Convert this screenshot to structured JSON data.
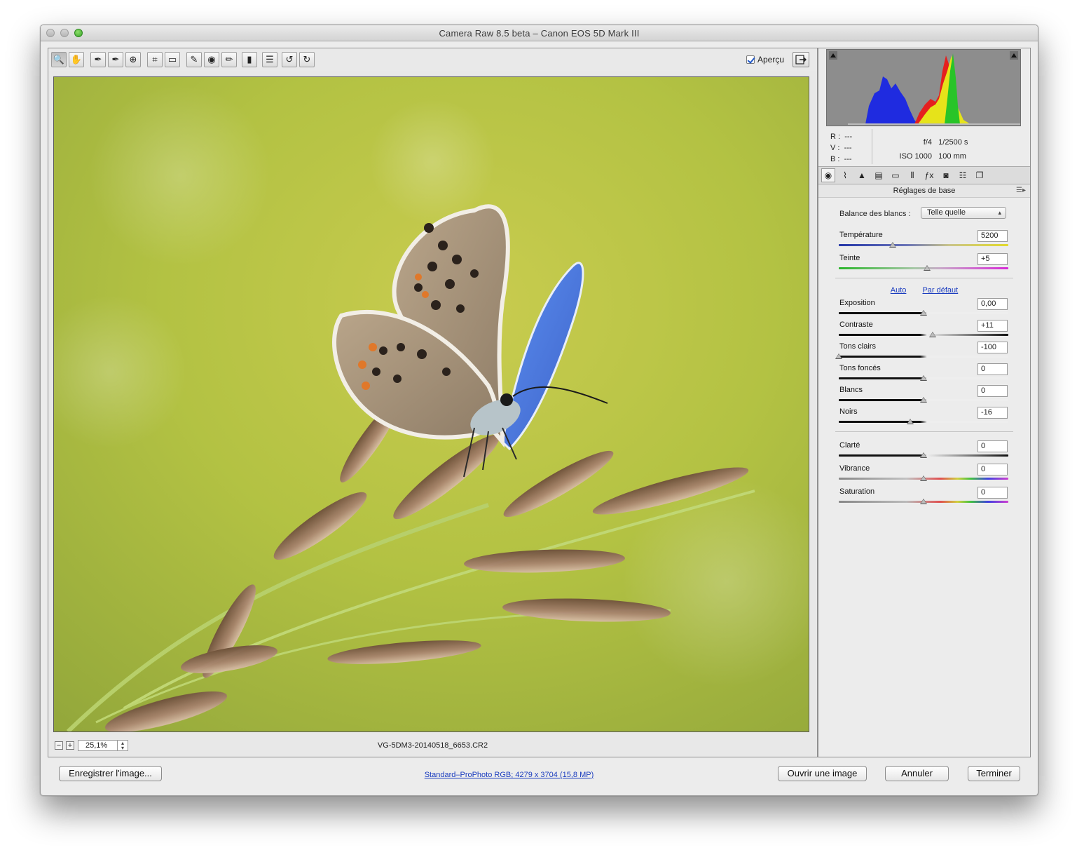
{
  "window": {
    "title": "Camera Raw 8.5 beta  –  Canon EOS 5D Mark III"
  },
  "toolbar": {
    "tools": [
      {
        "name": "zoom-tool",
        "icon": "magnifier-icon",
        "glyph": "🔍"
      },
      {
        "name": "hand-tool",
        "icon": "hand-icon",
        "glyph": "✋"
      },
      {
        "name": "white-balance-tool",
        "icon": "eyedropper-icon",
        "glyph": "✒"
      },
      {
        "name": "color-sampler-tool",
        "icon": "color-sampler-icon",
        "glyph": "✒"
      },
      {
        "name": "targeted-adjustment-tool",
        "icon": "target-icon",
        "glyph": "⊕"
      },
      {
        "name": "crop-tool",
        "icon": "crop-icon",
        "glyph": "⌗"
      },
      {
        "name": "straighten-tool",
        "icon": "level-icon",
        "glyph": "▭"
      },
      {
        "name": "spot-removal-tool",
        "icon": "brush-spot-icon",
        "glyph": "✎"
      },
      {
        "name": "red-eye-tool",
        "icon": "eye-icon",
        "glyph": "◉"
      },
      {
        "name": "adjustment-brush-tool",
        "icon": "brush-icon",
        "glyph": "✏"
      },
      {
        "name": "graduated-filter-tool",
        "icon": "gradient-icon",
        "glyph": "▮"
      },
      {
        "name": "preferences-tool",
        "icon": "list-icon",
        "glyph": "☰"
      },
      {
        "name": "rotate-left-tool",
        "icon": "rotate-left-icon",
        "glyph": "↺"
      },
      {
        "name": "rotate-right-tool",
        "icon": "rotate-right-icon",
        "glyph": "↻"
      }
    ],
    "preview_label": "Aperçu",
    "preview_checked": true
  },
  "status": {
    "zoom": "25,1%",
    "filename": "VG-5DM3-20140518_6653.CR2"
  },
  "readout": {
    "r_label": "R :",
    "r_value": "---",
    "v_label": "V :",
    "v_value": "---",
    "b_label": "B :",
    "b_value": "---",
    "aperture": "f/4",
    "shutter": "1/2500 s",
    "iso": "ISO 1000",
    "focal": "100 mm"
  },
  "panel": {
    "tabs": [
      "aperture-icon",
      "curve-icon",
      "triangle-icon",
      "split-icon",
      "bar-icon",
      "lens-icon",
      "fx-icon",
      "camera-icon",
      "sliders-icon",
      "presets-icon"
    ],
    "title": "Réglages de base",
    "white_balance_label": "Balance des blancs :",
    "white_balance_value": "Telle quelle",
    "auto_label": "Auto",
    "default_label": "Par défaut",
    "sliders": [
      {
        "label": "Température",
        "value": "5200",
        "pos": 0.32
      },
      {
        "label": "Teinte",
        "value": "+5",
        "pos": 0.52
      },
      {
        "label": "Exposition",
        "value": "0,00",
        "pos": 0.5
      },
      {
        "label": "Contraste",
        "value": "+11",
        "pos": 0.555
      },
      {
        "label": "Tons clairs",
        "value": "-100",
        "pos": 0.0
      },
      {
        "label": "Tons foncés",
        "value": "0",
        "pos": 0.5
      },
      {
        "label": "Blancs",
        "value": "0",
        "pos": 0.5
      },
      {
        "label": "Noirs",
        "value": "-16",
        "pos": 0.42
      },
      {
        "label": "Clarté",
        "value": "0",
        "pos": 0.5
      },
      {
        "label": "Vibrance",
        "value": "0",
        "pos": 0.5
      },
      {
        "label": "Saturation",
        "value": "0",
        "pos": 0.5
      }
    ]
  },
  "footer": {
    "save_label": "Enregistrer l'image...",
    "workflow_link": "Standard–ProPhoto RGB; 4279 x 3704 (15,8 MP)",
    "open_label": "Ouvrir une image",
    "cancel_label": "Annuler",
    "done_label": "Terminer"
  },
  "colors": {
    "link": "#1a3cbf",
    "histogram_bg": "#8d8d8d"
  }
}
